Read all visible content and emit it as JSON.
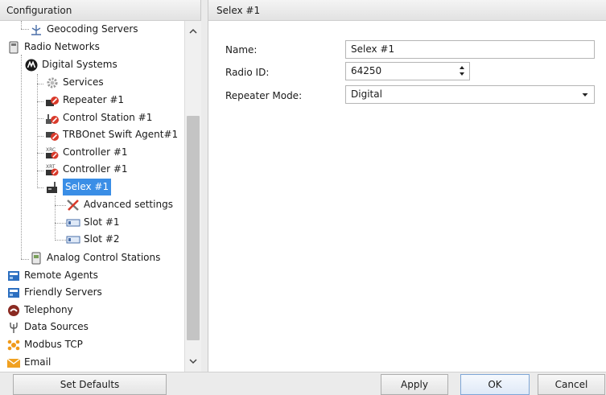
{
  "left_panel": {
    "title": "Configuration"
  },
  "tree": [
    {
      "label": "Geocoding Servers",
      "icon": "antenna-icon",
      "glyph": "⚲"
    },
    {
      "label": "Radio Networks",
      "icon": "radio-networks-icon",
      "glyph": "▯"
    },
    {
      "label": "Digital Systems",
      "icon": "motorola-logo-icon",
      "glyph": "Ⓜ"
    },
    {
      "label": "Services",
      "icon": "gear-icon",
      "glyph": "⚙"
    },
    {
      "label": "Repeater #1",
      "icon": "repeater-icon",
      "glyph": "■"
    },
    {
      "label": "Control Station #1",
      "icon": "control-station-icon",
      "glyph": "▲"
    },
    {
      "label": "TRBOnet Swift Agent#1",
      "icon": "swift-agent-icon",
      "glyph": "▬"
    },
    {
      "label": "Controller #1",
      "icon": "xrc-controller-icon",
      "glyph": "X"
    },
    {
      "label": "Controller #1",
      "icon": "xrt-controller-icon",
      "glyph": "X"
    },
    {
      "label": "Selex #1",
      "icon": "selex-radio-icon",
      "glyph": "▟"
    },
    {
      "label": "Advanced settings",
      "icon": "tools-icon",
      "glyph": "✕"
    },
    {
      "label": "Slot #1",
      "icon": "slot-icon",
      "glyph": "▭"
    },
    {
      "label": "Slot #2",
      "icon": "slot-icon",
      "glyph": "▭"
    },
    {
      "label": "Analog Control Stations",
      "icon": "analog-station-icon",
      "glyph": "▯"
    },
    {
      "label": "Remote Agents",
      "icon": "remote-agents-icon",
      "glyph": "▣"
    },
    {
      "label": "Friendly Servers",
      "icon": "friendly-servers-icon",
      "glyph": "▣"
    },
    {
      "label": "Telephony",
      "icon": "telephone-icon",
      "glyph": "☎"
    },
    {
      "label": "Data Sources",
      "icon": "data-source-icon",
      "glyph": "Ψ"
    },
    {
      "label": "Modbus TCP",
      "icon": "modbus-icon",
      "glyph": "✱"
    },
    {
      "label": "Email",
      "icon": "envelope-icon",
      "glyph": "✉"
    }
  ],
  "right_panel": {
    "title": "Selex #1",
    "form": {
      "name_label": "Name:",
      "name_value": "Selex #1",
      "radio_id_label": "Radio ID:",
      "radio_id_value": "64250",
      "repeater_mode_label": "Repeater Mode:",
      "repeater_mode_value": "Digital"
    }
  },
  "buttons": {
    "set_defaults": "Set Defaults",
    "apply": "Apply",
    "ok": "OK",
    "cancel": "Cancel"
  },
  "colors": {
    "selection": "#3a8ee6",
    "motorola": "#1a1a1a",
    "repeater_red": "#d93a2b",
    "email_orange": "#f0a020",
    "modbus_orange": "#f09a1a",
    "agents_blue": "#2c6fc0"
  }
}
